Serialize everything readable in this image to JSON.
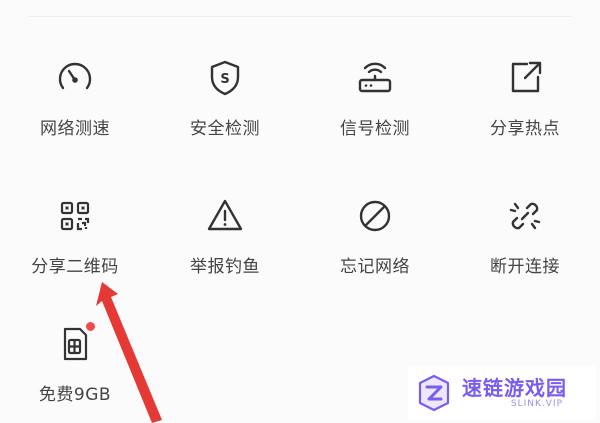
{
  "tiles": [
    {
      "label": "网络测速",
      "icon": "speedometer-icon"
    },
    {
      "label": "安全检测",
      "icon": "shield-s-icon"
    },
    {
      "label": "信号检测",
      "icon": "router-icon"
    },
    {
      "label": "分享热点",
      "icon": "share-out-icon"
    },
    {
      "label": "分享二维码",
      "icon": "qr-code-icon"
    },
    {
      "label": "举报钓鱼",
      "icon": "warning-icon"
    },
    {
      "label": "忘记网络",
      "icon": "forbidden-icon"
    },
    {
      "label": "断开连接",
      "icon": "broken-link-icon"
    },
    {
      "label": "免费9GB",
      "icon": "sim-card-icon",
      "badge": true
    }
  ],
  "annotation": {
    "arrow_color": "#e53935",
    "target": "分享二维码"
  },
  "watermark": {
    "title": "速链游戏园",
    "subtitle": "SLINK.VIP",
    "color": "#7b5cf0"
  }
}
